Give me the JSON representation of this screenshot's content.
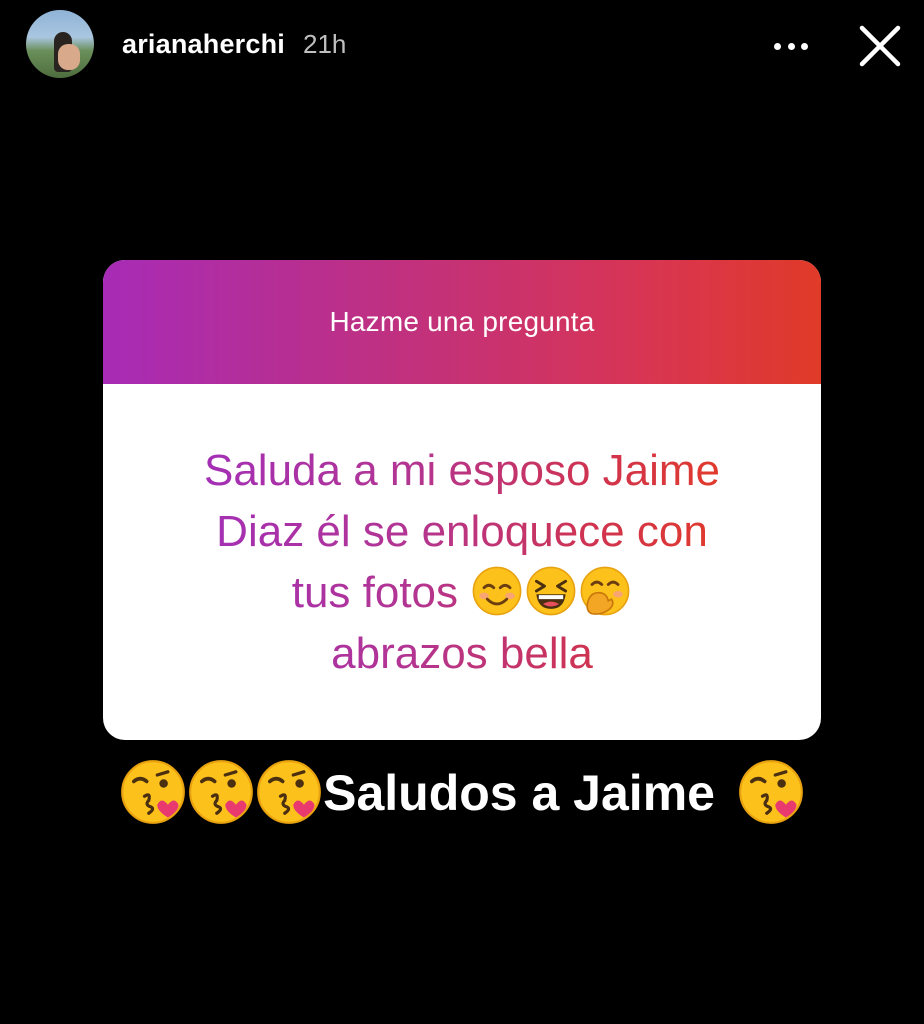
{
  "header": {
    "username": "arianaherchi",
    "time": "21h"
  },
  "question_sticker": {
    "title": "Hazme una pregunta",
    "line1": "Saluda a mi esposo Jaime",
    "line2": "Diaz él se enloquece con",
    "line3": "tus fotos",
    "line4": "abrazos bella",
    "line3_emojis": [
      "smiling-face-icon",
      "laughing-face-icon",
      "hand-over-mouth-face-icon"
    ]
  },
  "reply": {
    "text": "Saludos a Jaime",
    "emojis": [
      "kissing-face-icon",
      "kissing-face-icon",
      "kissing-face-icon",
      "kissing-face-icon"
    ]
  },
  "colors": {
    "background": "#000000",
    "gradient_start": "#a72bb6",
    "gradient_end": "#e03a28"
  }
}
